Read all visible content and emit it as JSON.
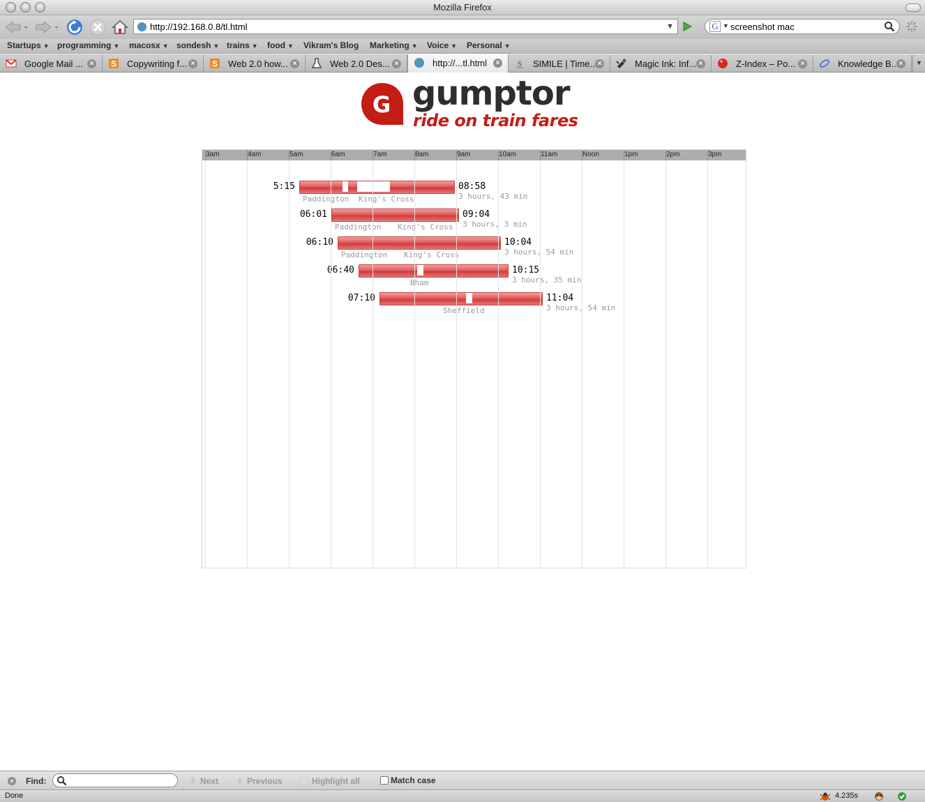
{
  "window": {
    "title": "Mozilla Firefox"
  },
  "navigation": {
    "url": "http://192.168.0.8/tl.html",
    "search_engine_glyph": "G",
    "search_value": "screenshot mac"
  },
  "bookmarks": [
    {
      "label": "Startups",
      "dropdown": true
    },
    {
      "label": "programming",
      "dropdown": true
    },
    {
      "label": "macosx",
      "dropdown": true
    },
    {
      "label": "sondesh",
      "dropdown": true
    },
    {
      "label": "trains",
      "dropdown": true
    },
    {
      "label": "food",
      "dropdown": true
    },
    {
      "label": "Vikram's Blog",
      "dropdown": false
    },
    {
      "label": "Marketing",
      "dropdown": true
    },
    {
      "label": "Voice",
      "dropdown": true
    },
    {
      "label": "Personal",
      "dropdown": true
    }
  ],
  "tabs": [
    {
      "label": "Google Mail ...",
      "icon": "gmail-icon",
      "active": false
    },
    {
      "label": "Copywriting f...",
      "icon": "orange-s-icon",
      "active": false
    },
    {
      "label": "Web 2.0 how...",
      "icon": "orange-s-icon",
      "active": false
    },
    {
      "label": "Web 2.0 Des...",
      "icon": "flask-icon",
      "active": false
    },
    {
      "label": "http://...tl.html",
      "icon": "globe-icon",
      "active": true
    },
    {
      "label": "SIMILE | Time...",
      "icon": "simile-icon",
      "active": false
    },
    {
      "label": "Magic Ink: Inf...",
      "icon": "paint-icon",
      "active": false
    },
    {
      "label": "Z-Index – Po...",
      "icon": "red-ball-icon",
      "active": false
    },
    {
      "label": "Knowledge B...",
      "icon": "blue-swoosh-icon",
      "active": false
    }
  ],
  "logo": {
    "word": "gumptor",
    "tagline": "ride on train fares",
    "badge_letter": "G",
    "brand_color": "#c31d16"
  },
  "timeline": {
    "hours": [
      "3am",
      "4am",
      "5am",
      "6am",
      "7am",
      "8am",
      "9am",
      "10am",
      "11am",
      "Noon",
      "1pm",
      "2pm",
      "3pm"
    ],
    "trips": [
      {
        "depart": "5:15",
        "arrive": "08:58",
        "duration": "3 hours, 43 min",
        "stations": [
          "Paddington",
          "King's Cross"
        ]
      },
      {
        "depart": "06:01",
        "arrive": "09:04",
        "duration": "3 hours, 3 min",
        "stations": [
          "Paddington",
          "King's Cross"
        ]
      },
      {
        "depart": "06:10",
        "arrive": "10:04",
        "duration": "3 hours, 54 min",
        "stations": [
          "Paddington",
          "King's Cross"
        ]
      },
      {
        "depart": "06:40",
        "arrive": "10:15",
        "duration": "3 hours, 35 min",
        "stations": [
          "Bham"
        ]
      },
      {
        "depart": "07:10",
        "arrive": "11:04",
        "duration": "3 hours, 54 min",
        "stations": [
          "Sheffield"
        ]
      }
    ]
  },
  "findbar": {
    "label": "Find:",
    "value": "",
    "next": "Next",
    "previous": "Previous",
    "highlight": "Highlight all",
    "match_case": "Match case"
  },
  "status": {
    "text": "Done",
    "load_time": "4.235s"
  },
  "colors": {
    "bar_red": "#e25c5c",
    "accent_blue": "#3d7ad6"
  }
}
